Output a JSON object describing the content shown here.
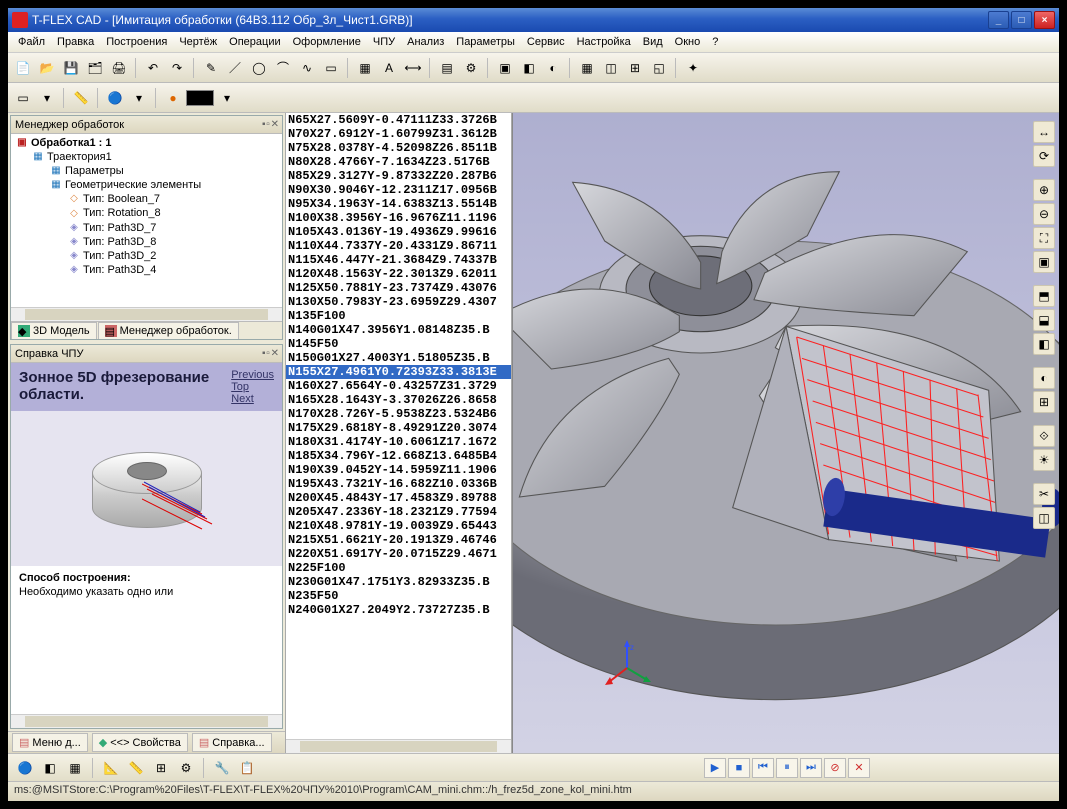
{
  "app": {
    "name": "T-FLEX CAD",
    "doc": "[Имитация обработки (64B3.112 Обр_3л_Чист1.GRB)]"
  },
  "menu": [
    "Файл",
    "Правка",
    "Построения",
    "Чертёж",
    "Операции",
    "Оформление",
    "ЧПУ",
    "Анализ",
    "Параметры",
    "Сервис",
    "Настройка",
    "Вид",
    "Окно",
    "?"
  ],
  "panels": {
    "manager_title": "Менеджер обработок",
    "help_title": "Справка ЧПУ"
  },
  "tree": {
    "root": "Обработка1 : 1",
    "items": [
      {
        "label": "Траектория1",
        "indent": 1,
        "icon": "grid"
      },
      {
        "label": "Параметры",
        "indent": 2,
        "icon": "grid"
      },
      {
        "label": "Геометрические элементы",
        "indent": 2,
        "icon": "grid"
      },
      {
        "label": "Тип: Boolean_7",
        "indent": 3,
        "icon": "path"
      },
      {
        "label": "Тип: Rotation_8",
        "indent": 3,
        "icon": "path"
      },
      {
        "label": "Тип: Path3D_7",
        "indent": 3,
        "icon": "path2"
      },
      {
        "label": "Тип: Path3D_8",
        "indent": 3,
        "icon": "path2"
      },
      {
        "label": "Тип: Path3D_2",
        "indent": 3,
        "icon": "path2"
      },
      {
        "label": "Тип: Path3D_4",
        "indent": 3,
        "icon": "path2"
      }
    ]
  },
  "tabs_left": [
    {
      "label": "3D Модель"
    },
    {
      "label": "Менеджер обработок."
    }
  ],
  "help": {
    "heading": "Зонное 5D фрезерование области.",
    "links": [
      "Previous",
      "Top",
      "Next"
    ],
    "sub_head": "Способ построения:",
    "sub_text": "Необходимо указать одно или"
  },
  "status_tabs": [
    "Меню д...",
    "Свойства",
    "Справка..."
  ],
  "gcode_selected": 18,
  "gcode": [
    "N65X27.5609Y-0.47111Z33.3726B",
    "N70X27.6912Y-1.60799Z31.3612B",
    "N75X28.0378Y-4.52098Z26.8511B",
    "N80X28.4766Y-7.1634Z23.5176B",
    "N85X29.3127Y-9.87332Z20.287B6",
    "N90X30.9046Y-12.2311Z17.0956B",
    "N95X34.1963Y-14.6383Z13.5514B",
    "N100X38.3956Y-16.9676Z11.1196",
    "N105X43.0136Y-19.4936Z9.99616",
    "N110X44.7337Y-20.4331Z9.86711",
    "N115X46.447Y-21.3684Z9.74337B",
    "N120X48.1563Y-22.3013Z9.62011",
    "N125X50.7881Y-23.7374Z9.43076",
    "N130X50.7983Y-23.6959Z29.4307",
    "N135F100",
    "N140G01X47.3956Y1.08148Z35.B",
    "N145F50",
    "N150G01X27.4003Y1.51805Z35.B",
    "N155X27.4961Y0.72393Z33.3813E",
    "N160X27.6564Y-0.43257Z31.3729",
    "N165X28.1643Y-3.37026Z26.8658",
    "N170X28.726Y-5.9538Z23.5324B6",
    "N175X29.6818Y-8.49291Z20.3074",
    "N180X31.4174Y-10.6061Z17.1672",
    "N185X34.796Y-12.668Z13.6485B4",
    "N190X39.0452Y-14.5959Z11.1906",
    "N195X43.7321Y-16.682Z10.0336B",
    "N200X45.4843Y-17.4583Z9.89788",
    "N205X47.2336Y-18.2321Z9.77594",
    "N210X48.9781Y-19.0039Z9.65443",
    "N215X51.6621Y-20.1913Z9.46746",
    "N220X51.6917Y-20.0715Z29.4671",
    "N225F100",
    "N230G01X47.1751Y3.82933Z35.B",
    "N235F50",
    "N240G01X27.2049Y2.73727Z35.B"
  ],
  "statusbar": "ms:@MSITStore:C:\\Program%20Files\\T-FLEX\\T-FLEX%20ЧПУ%2010\\Program\\CAM_mini.chm::/h_frez5d_zone_kol_mini.htm"
}
